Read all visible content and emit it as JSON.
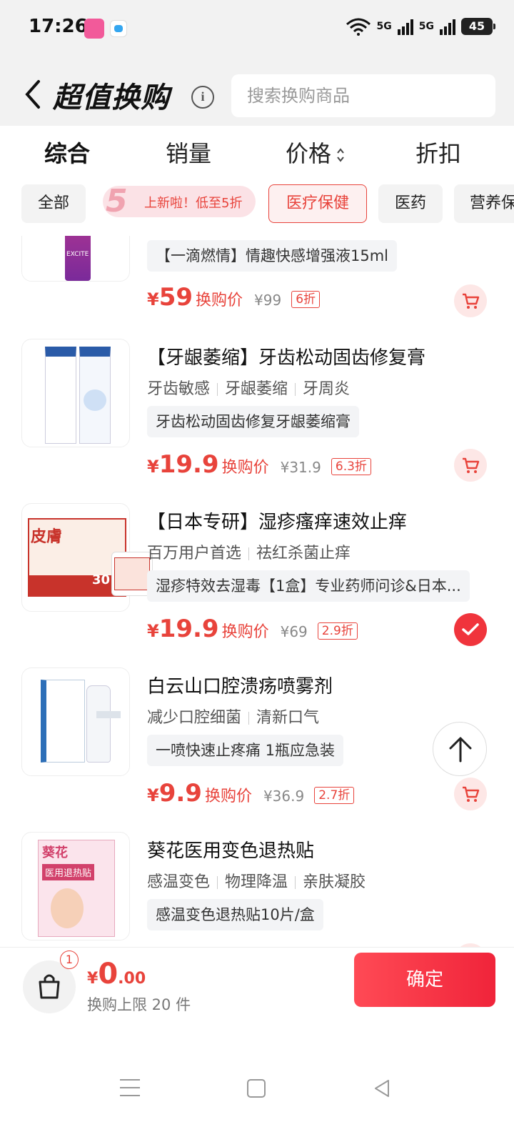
{
  "status_bar": {
    "time": "17:26",
    "network1": "5G",
    "network2": "5G",
    "battery": "45"
  },
  "header": {
    "title": "超值换购",
    "search_placeholder": "搜索换购商品"
  },
  "sort_tabs": [
    {
      "label": "综合",
      "active": true
    },
    {
      "label": "销量",
      "active": false
    },
    {
      "label": "价格",
      "active": false
    },
    {
      "label": "折扣",
      "active": false
    }
  ],
  "chips": {
    "all": "全部",
    "promo_num": "5",
    "promo_text": "上新啦！低至5折",
    "medical": "医疗保健",
    "medicine": "医药",
    "nutrition": "营养保"
  },
  "products": [
    {
      "desc": "【一滴燃情】情趣快感增强液15ml",
      "thumb_text": "EXCITE",
      "currency": "¥",
      "price": "59",
      "swap_label": "换购价",
      "orig_price": "¥99",
      "discount": "6折",
      "state": "cart"
    },
    {
      "title": "【牙龈萎缩】牙齿松动固齿修复膏",
      "tags": [
        "牙齿敏感",
        "牙龈萎缩",
        "牙周炎"
      ],
      "desc": "牙齿松动固齿修复牙龈萎缩膏",
      "currency": "¥",
      "price": "19.9",
      "swap_label": "换购价",
      "orig_price": "¥31.9",
      "discount": "6.3折",
      "state": "cart"
    },
    {
      "title": "【日本专研】湿疹瘙痒速效止痒",
      "tags": [
        "百万用户首选",
        "祛红杀菌止痒"
      ],
      "desc": "湿疹特效去湿毒【1盒】专业药师问诊&日本...",
      "thumb_text": "皮膚",
      "thumb_badge": "30",
      "currency": "¥",
      "price": "19.9",
      "swap_label": "换购价",
      "orig_price": "¥69",
      "discount": "2.9折",
      "state": "selected"
    },
    {
      "title": "白云山口腔溃疡喷雾剂",
      "tags": [
        "减少口腔细菌",
        "清新口气"
      ],
      "desc": "一喷快速止疼痛 1瓶应急装",
      "currency": "¥",
      "price": "9.9",
      "swap_label": "换购价",
      "orig_price": "¥36.9",
      "discount": "2.7折",
      "state": "cart"
    },
    {
      "title": "葵花医用变色退热贴",
      "tags": [
        "感温变色",
        "物理降温",
        "亲肤凝胶"
      ],
      "desc": "感温变色退热贴10片/盒",
      "thumb_text": "葵花",
      "thumb_sub": "医用退热贴",
      "state": "cart"
    }
  ],
  "bottom_bar": {
    "cart_count": "1",
    "currency": "¥",
    "total_int": "0",
    "total_dec": ".00",
    "limit_text": "换购上限 20 件",
    "confirm_label": "确定"
  },
  "colors": {
    "accent": "#e8433b",
    "confirm": "#f0243a",
    "chip_bg": "#f3f3f3",
    "tag_bg": "#f3f4f6"
  }
}
